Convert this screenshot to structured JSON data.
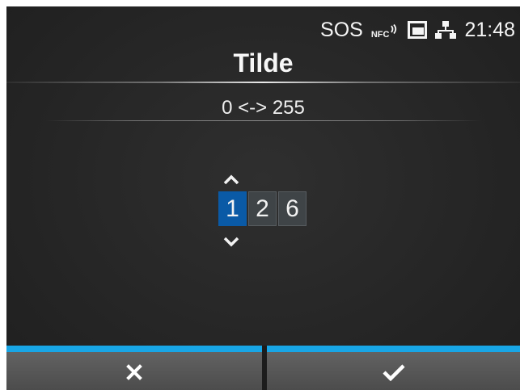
{
  "status_bar": {
    "sos_label": "SOS",
    "nfc_label": "NFC",
    "icons": [
      "nfc-icon",
      "sd-card-icon",
      "network-icon"
    ],
    "time": "21:48"
  },
  "header": {
    "title": "Tilde"
  },
  "range": {
    "text": "0 <-> 255"
  },
  "digit_input": {
    "digits": [
      "1",
      "2",
      "6"
    ],
    "active_index": 0,
    "up_icon": "chevron-up-icon",
    "down_icon": "chevron-down-icon"
  },
  "footer": {
    "cancel_icon": "close-icon",
    "ok_icon": "checkmark-icon"
  },
  "colors": {
    "accent_bar": "#18a6e6",
    "active_digit": "#0a5aa6",
    "background": "#262626"
  }
}
